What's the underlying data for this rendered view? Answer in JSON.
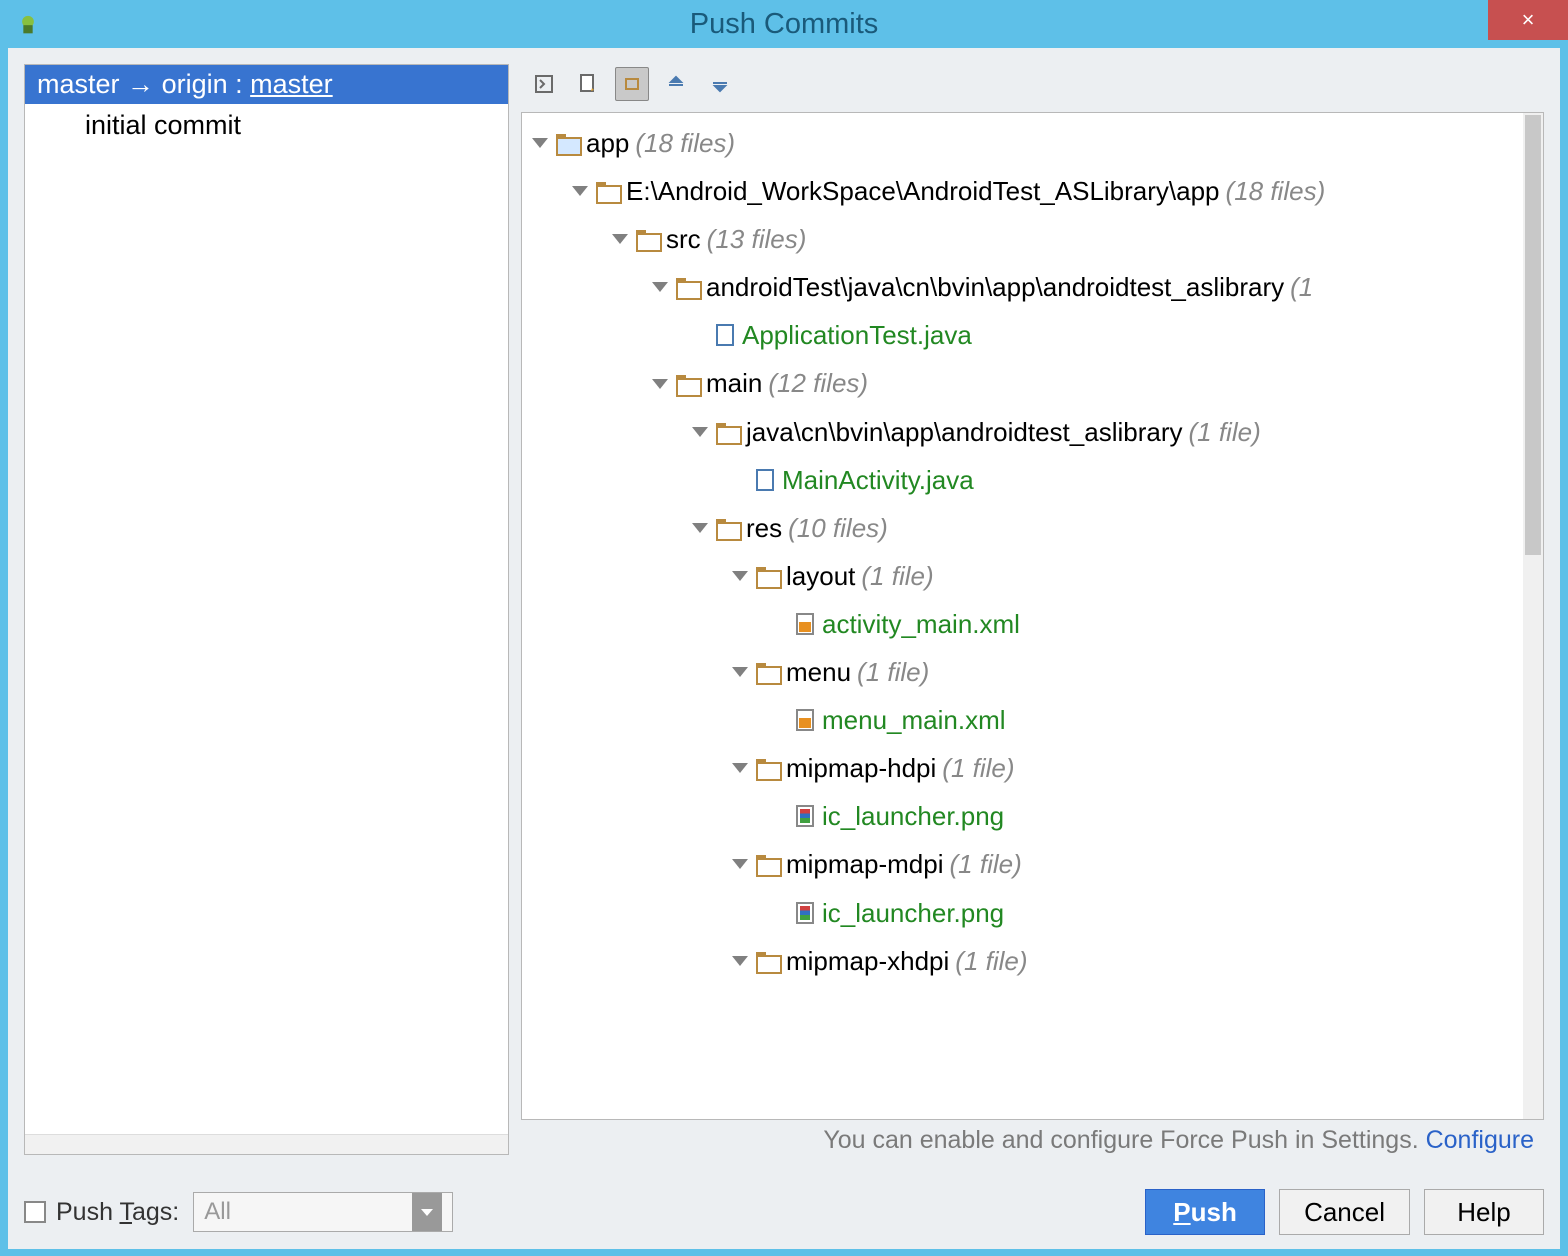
{
  "window": {
    "title": "Push Commits"
  },
  "left": {
    "branch_local": "master",
    "branch_arrow": "→",
    "branch_remote": "origin",
    "branch_sep": ":",
    "branch_target": "master",
    "commit": "initial commit"
  },
  "tree": {
    "app": {
      "label": "app",
      "count": "(18 files)"
    },
    "path": {
      "label": "E:\\Android_WorkSpace\\AndroidTest_ASLibrary\\app",
      "count": "(18 files)"
    },
    "src": {
      "label": "src",
      "count": "(13 files)"
    },
    "androidTest": {
      "label": "androidTest\\java\\cn\\bvin\\app\\androidtest_aslibrary",
      "count": "(1"
    },
    "applicationTest": "ApplicationTest.java",
    "main": {
      "label": "main",
      "count": "(12 files)"
    },
    "javaPkg": {
      "label": "java\\cn\\bvin\\app\\androidtest_aslibrary",
      "count": "(1 file)"
    },
    "mainActivity": "MainActivity.java",
    "res": {
      "label": "res",
      "count": "(10 files)"
    },
    "layout": {
      "label": "layout",
      "count": "(1 file)"
    },
    "activityMain": "activity_main.xml",
    "menu": {
      "label": "menu",
      "count": "(1 file)"
    },
    "menuMain": "menu_main.xml",
    "mipmapHdpi": {
      "label": "mipmap-hdpi",
      "count": "(1 file)"
    },
    "icHdpi": "ic_launcher.png",
    "mipmapMdpi": {
      "label": "mipmap-mdpi",
      "count": "(1 file)"
    },
    "icMdpi": "ic_launcher.png",
    "mipmapXhdpi": {
      "label": "mipmap-xhdpi",
      "count": "(1 file)"
    }
  },
  "hint": {
    "text": "You can enable and configure Force Push in Settings.",
    "link": "Configure"
  },
  "bottom": {
    "push_tags_label": "Push Tags:",
    "push_tags_mn": "T",
    "select_value": "All",
    "push": "Push",
    "push_mn": "P",
    "cancel": "Cancel",
    "help": "Help"
  }
}
